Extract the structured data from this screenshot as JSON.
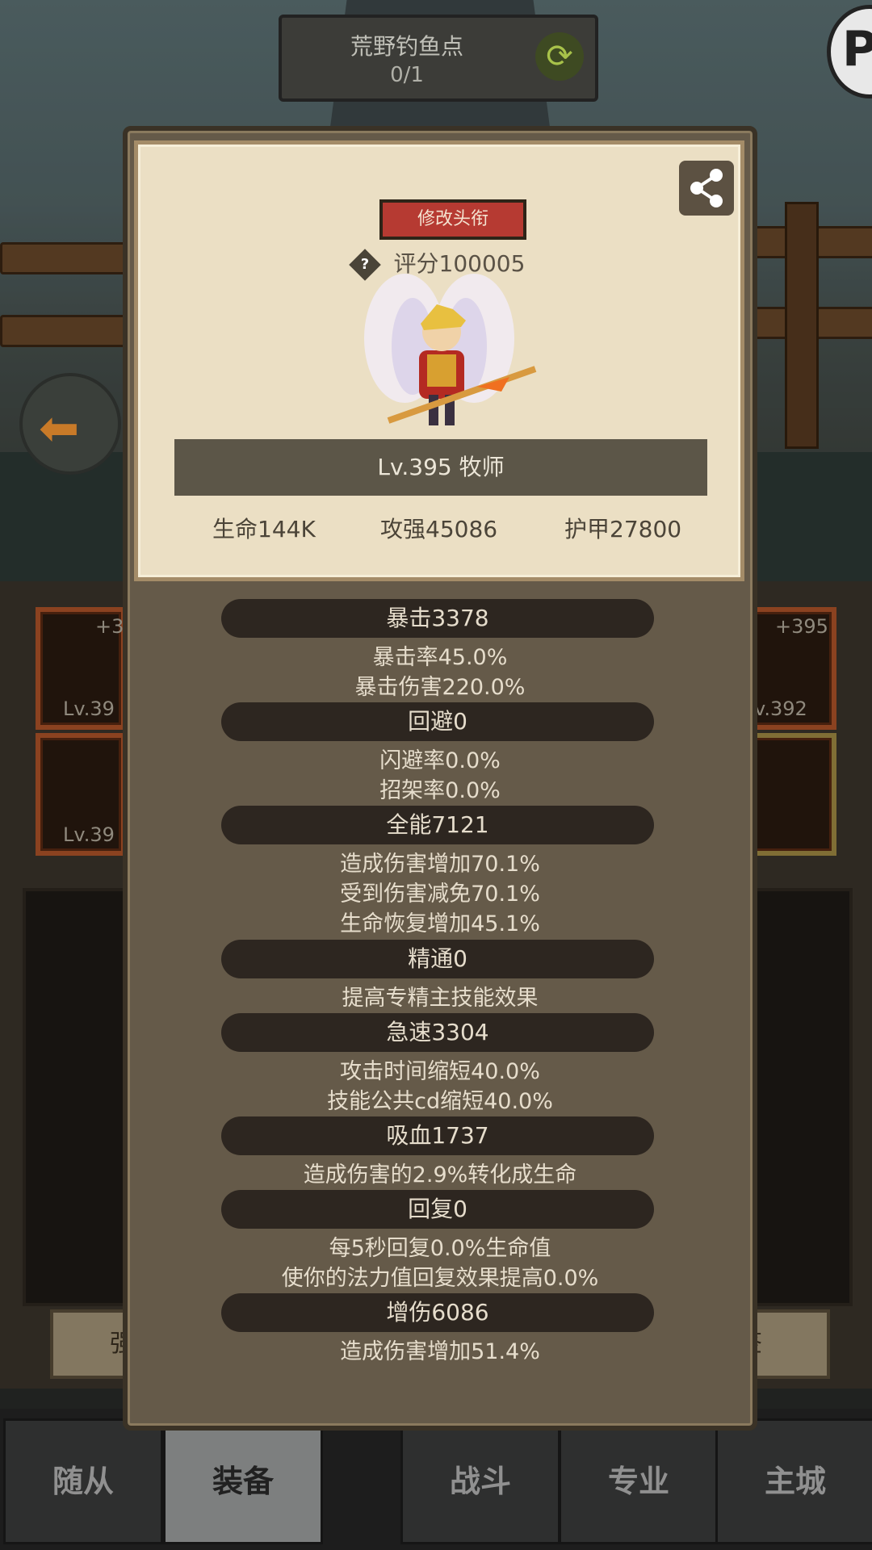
{
  "header": {
    "location_name": "荒野钓鱼点",
    "location_count": "0/1"
  },
  "background": {
    "slots": {
      "top_left_level": "+3",
      "top_right_level": "+395",
      "left_lv_1": "Lv.39",
      "right_lv_1": "v.392",
      "left_lv_2": "Lv.39"
    },
    "side_buttons": {
      "left": "强",
      "right": "签"
    }
  },
  "bottom_nav": {
    "tabs": [
      "随从",
      "装备",
      "战斗",
      "专业",
      "主城"
    ]
  },
  "profile": {
    "rename_label": "修改头衔",
    "help_symbol": "?",
    "score": "评分100005",
    "level_class": "Lv.395 牧师",
    "hp": "生命144K",
    "attack": "攻强45086",
    "armor": "护甲27800"
  },
  "stats": [
    {
      "name": "暴击3378",
      "details": [
        "暴击率45.0%",
        "暴击伤害220.0%"
      ]
    },
    {
      "name": "回避0",
      "details": [
        "闪避率0.0%",
        "招架率0.0%"
      ]
    },
    {
      "name": "全能7121",
      "details": [
        "造成伤害增加70.1%",
        "受到伤害减免70.1%",
        "生命恢复增加45.1%"
      ]
    },
    {
      "name": "精通0",
      "details": [
        "提高专精主技能效果"
      ]
    },
    {
      "name": "急速3304",
      "details": [
        "攻击时间缩短40.0%",
        "技能公共cd缩短40.0%"
      ]
    },
    {
      "name": "吸血1737",
      "details": [
        "造成伤害的2.9%转化成生命"
      ]
    },
    {
      "name": "回复0",
      "details": [
        "每5秒回复0.0%生命值",
        "使你的法力值回复效果提高0.0%"
      ]
    },
    {
      "name": "增伤6086",
      "details": [
        "造成伤害增加51.4%"
      ]
    }
  ]
}
